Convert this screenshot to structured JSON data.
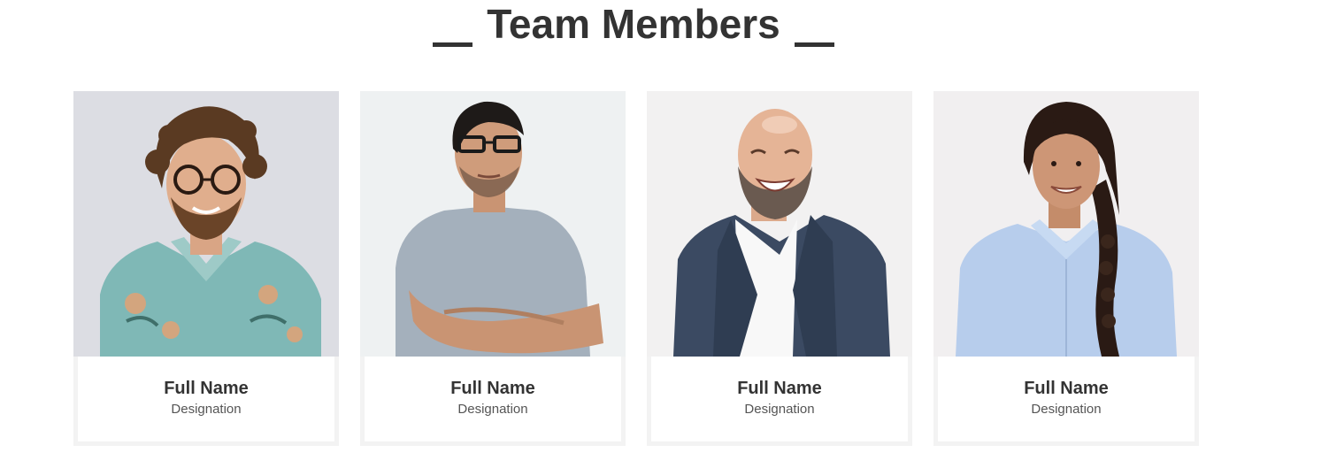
{
  "section": {
    "title": "Team Members"
  },
  "members": [
    {
      "name": "Full Name",
      "designation": "Designation"
    },
    {
      "name": "Full Name",
      "designation": "Designation"
    },
    {
      "name": "Full Name",
      "designation": "Designation"
    },
    {
      "name": "Full Name",
      "designation": "Designation"
    }
  ]
}
